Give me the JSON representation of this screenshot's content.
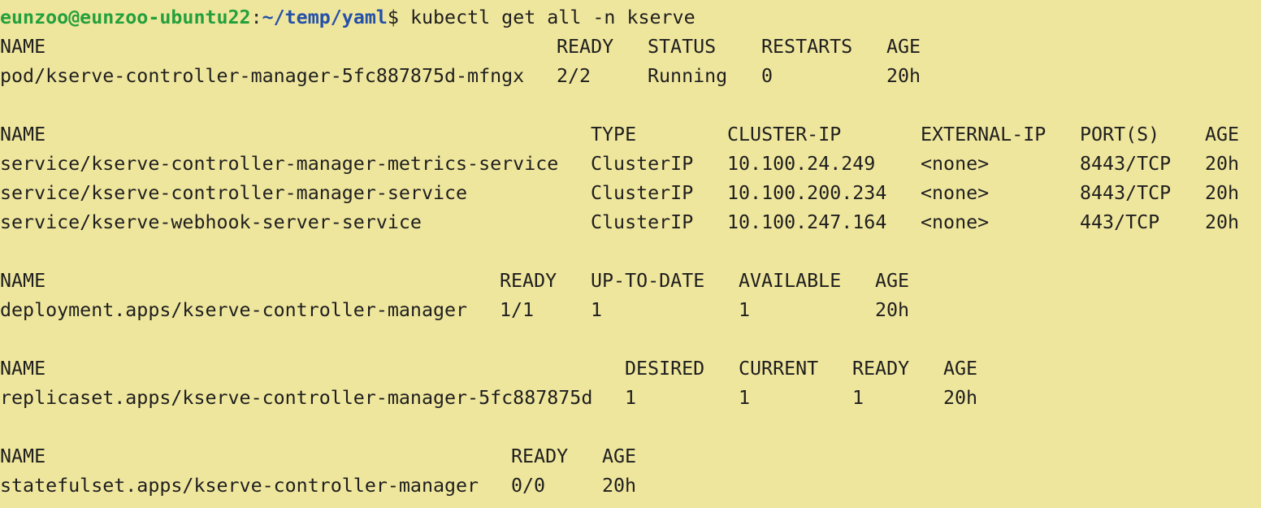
{
  "prompt": {
    "user_host": "eunzoo@eunzoo-ubuntu22",
    "colon": ":",
    "path": "~/temp/yaml",
    "dollar": "$",
    "command": " kubectl get all -n kserve"
  },
  "pods": {
    "headers": [
      "NAME",
      "READY",
      "STATUS",
      "RESTARTS",
      "AGE"
    ],
    "rows": [
      [
        "pod/kserve-controller-manager-5fc887875d-mfngx",
        "2/2",
        "Running",
        "0",
        "20h"
      ]
    ]
  },
  "services": {
    "headers": [
      "NAME",
      "TYPE",
      "CLUSTER-IP",
      "EXTERNAL-IP",
      "PORT(S)",
      "AGE"
    ],
    "rows": [
      [
        "service/kserve-controller-manager-metrics-service",
        "ClusterIP",
        "10.100.24.249",
        "<none>",
        "8443/TCP",
        "20h"
      ],
      [
        "service/kserve-controller-manager-service",
        "ClusterIP",
        "10.100.200.234",
        "<none>",
        "8443/TCP",
        "20h"
      ],
      [
        "service/kserve-webhook-server-service",
        "ClusterIP",
        "10.100.247.164",
        "<none>",
        "443/TCP",
        "20h"
      ]
    ]
  },
  "deployments": {
    "headers": [
      "NAME",
      "READY",
      "UP-TO-DATE",
      "AVAILABLE",
      "AGE"
    ],
    "rows": [
      [
        "deployment.apps/kserve-controller-manager",
        "1/1",
        "1",
        "1",
        "20h"
      ]
    ]
  },
  "replicasets": {
    "headers": [
      "NAME",
      "DESIRED",
      "CURRENT",
      "READY",
      "AGE"
    ],
    "rows": [
      [
        "replicaset.apps/kserve-controller-manager-5fc887875d",
        "1",
        "1",
        "1",
        "20h"
      ]
    ]
  },
  "statefulsets": {
    "headers": [
      "NAME",
      "READY",
      "AGE"
    ],
    "rows": [
      [
        "statefulset.apps/kserve-controller-manager",
        "0/0",
        "20h"
      ]
    ]
  }
}
